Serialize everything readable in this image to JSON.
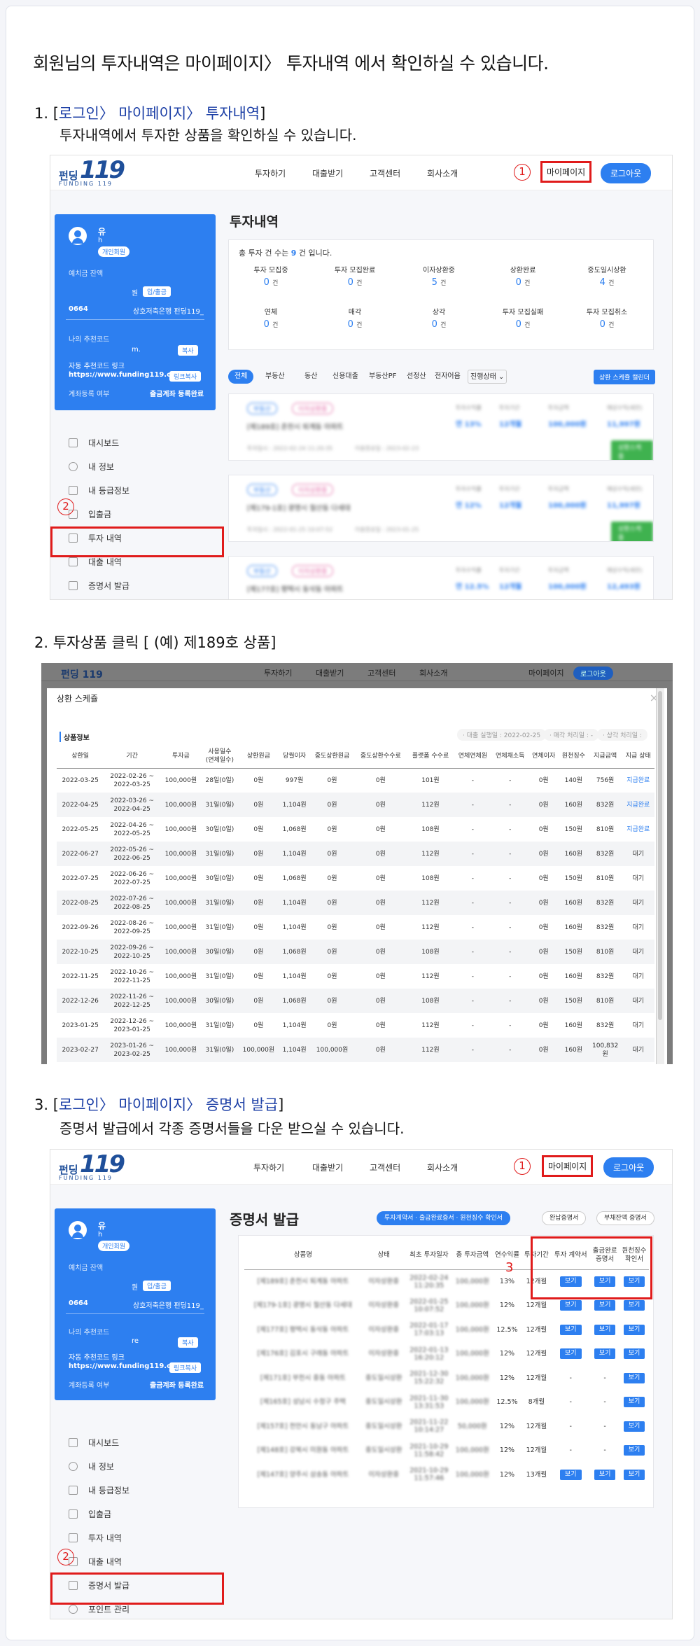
{
  "intro": "회원님의 투자내역은 마이페이지〉 투자내역 에서 확인하실 수 있습니다.",
  "sections": [
    {
      "num": "1. [",
      "path": "로그인〉 마이페이지〉 투자내역",
      "close": "]",
      "desc": "투자내역에서 투자한 상품을 확인하실 수 있습니다."
    },
    {
      "title": "2. 투자상품 클릭 [ (예) 제189호 상품]"
    },
    {
      "num": "3. [",
      "path": "로그인〉 마이페이지〉 증명서 발급",
      "close": "]",
      "desc": "증명서 발급에서 각종 증명서들을 다운 받으실 수 있습니다."
    }
  ],
  "site": {
    "logo_ko": "펀딩",
    "logo_mark": "119",
    "logo_en": "FUNDING 119",
    "nav": [
      "투자하기",
      "대출받기",
      "고객센터",
      "회사소개"
    ],
    "mypage": "마이페이지",
    "logout": "로그아웃"
  },
  "markers": {
    "one": "1",
    "two": "2",
    "three": "3"
  },
  "profile": {
    "name": "유",
    "handle": "h",
    "member_tag": "개인회원",
    "deposit_label": "예치금 잔액",
    "deposit_unit": "원",
    "deposit_btn": "입/출금",
    "account_no": "0664",
    "bank": "상호저축은행 펀딩119_",
    "ref_code_label": "나의 추천코드",
    "ref_code": "m.",
    "ref_code_3": "re",
    "copy_btn": "복사",
    "ref_link_label": "자동 추천코드 링크",
    "ref_link": "https://www.funding119.co.kr",
    "link_copy_btn": "링크복사",
    "reg_label": "계좌등록 여부",
    "reg_value": "출금계좌 등록완료"
  },
  "menu1": [
    "대시보드",
    "내 정보",
    "내 등급정보",
    "입출금",
    "투자 내역",
    "대출 내역",
    "증명서 발급"
  ],
  "menu3": [
    "대시보드",
    "내 정보",
    "내 등급정보",
    "입출금",
    "투자 내역",
    "대출 내역",
    "증명서 발급",
    "포인트 관리"
  ],
  "invest": {
    "title": "투자내역",
    "total_pre": "총 투자 건 수는",
    "total_count": "9",
    "total_post": "건 입니다.",
    "cells": [
      {
        "label": "투자 모집중",
        "value": "0",
        "unit": "건"
      },
      {
        "label": "투자 모집완료",
        "value": "0",
        "unit": "건"
      },
      {
        "label": "이자상환중",
        "value": "5",
        "unit": "건"
      },
      {
        "label": "상환완료",
        "value": "0",
        "unit": "건"
      },
      {
        "label": "중도일시상환",
        "value": "4",
        "unit": "건"
      },
      {
        "label": "연체",
        "value": "0",
        "unit": "건"
      },
      {
        "label": "매각",
        "value": "0",
        "unit": "건"
      },
      {
        "label": "상각",
        "value": "0",
        "unit": "건"
      },
      {
        "label": "투자 모집실패",
        "value": "0",
        "unit": "건"
      },
      {
        "label": "투자 모집취소",
        "value": "0",
        "unit": "건"
      }
    ],
    "filters": [
      "전체",
      "부동산",
      "동산",
      "신용대출",
      "부동산PF",
      "선정산",
      "전자어음",
      "진행상태 ⌄"
    ],
    "calendar_btn": "상환 스케쥴 캘린더",
    "cards": [
      {
        "badge1": "부동산",
        "badge2": "이자상환중",
        "name": "[제189호] 춘천시 퇴계동 아파트",
        "rate": "연 13%",
        "period": "12개월",
        "amount": "100,000원",
        "interest": "11,997원",
        "date": "투자일시 : 2022-02-24 11:20:35",
        "date2": "이용종료일 : 2023-02-23",
        "btn": "상환스케줄",
        "h1": "투자수익률",
        "h2": "투자기간",
        "h3": "투자금액",
        "h4": "예상수익(세전)"
      },
      {
        "badge1": "부동산",
        "badge2": "이자상환중",
        "name": "[제179-1호] 광명시 철산동 다세대",
        "rate": "연 12%",
        "period": "12개월",
        "amount": "100,000원",
        "interest": "11,997원",
        "date": "투자일시 : 2022-01-25 10:07:52",
        "date2": "이용종료일 : 2023-01-25",
        "btn": "상환스케줄",
        "h1": "투자수익률",
        "h2": "투자기간",
        "h3": "투자금액",
        "h4": "예상수익(세전)"
      },
      {
        "badge1": "부동산",
        "badge2": "이자상환중",
        "name": "[제177호] 평택시 동삭동 아파트",
        "rate": "연 12.5%",
        "period": "12개월",
        "amount": "100,000원",
        "interest": "12,493원",
        "h1": "투자수익률",
        "h2": "투자기간",
        "h3": "투자금액",
        "h4": "예상수익(세전)"
      }
    ]
  },
  "schedule": {
    "title": "상환 스케쥴",
    "close": "×",
    "section": "상품정보",
    "info1": "· 대출 실행일 : 2022-02-25",
    "info2": "· 매각 처리일 : -",
    "info3": "· 상각 처리일 :",
    "headers": [
      "상환일",
      "기간",
      "투자금",
      "사용일수\n(연체일수)",
      "상환원금",
      "당월이자",
      "중도상환원금",
      "중도상환수수료",
      "플랫폼 수수료",
      "연체연체원",
      "연체채소득",
      "연체이자",
      "원천징수",
      "지급금액",
      "지급 상태"
    ],
    "rows": [
      [
        "2022-03-25",
        "2022-02-26 ~\n2022-03-25",
        "100,000원",
        "28일(0일)",
        "0원",
        "997원",
        "0원",
        "0원",
        "101원",
        "-",
        "-",
        "0원",
        "140원",
        "756원",
        "지급완료"
      ],
      [
        "2022-04-25",
        "2022-03-26 ~\n2022-04-25",
        "100,000원",
        "31일(0일)",
        "0원",
        "1,104원",
        "0원",
        "0원",
        "112원",
        "-",
        "-",
        "0원",
        "160원",
        "832원",
        "지급완료"
      ],
      [
        "2022-05-25",
        "2022-04-26 ~\n2022-05-25",
        "100,000원",
        "30일(0일)",
        "0원",
        "1,068원",
        "0원",
        "0원",
        "108원",
        "-",
        "-",
        "0원",
        "150원",
        "810원",
        "지급완료"
      ],
      [
        "2022-06-27",
        "2022-05-26 ~\n2022-06-25",
        "100,000원",
        "31일(0일)",
        "0원",
        "1,104원",
        "0원",
        "0원",
        "112원",
        "-",
        "-",
        "0원",
        "160원",
        "832원",
        "대기"
      ],
      [
        "2022-07-25",
        "2022-06-26 ~\n2022-07-25",
        "100,000원",
        "30일(0일)",
        "0원",
        "1,068원",
        "0원",
        "0원",
        "108원",
        "-",
        "-",
        "0원",
        "150원",
        "810원",
        "대기"
      ],
      [
        "2022-08-25",
        "2022-07-26 ~\n2022-08-25",
        "100,000원",
        "31일(0일)",
        "0원",
        "1,104원",
        "0원",
        "0원",
        "112원",
        "-",
        "-",
        "0원",
        "160원",
        "832원",
        "대기"
      ],
      [
        "2022-09-26",
        "2022-08-26 ~\n2022-09-25",
        "100,000원",
        "31일(0일)",
        "0원",
        "1,104원",
        "0원",
        "0원",
        "112원",
        "-",
        "-",
        "0원",
        "160원",
        "832원",
        "대기"
      ],
      [
        "2022-10-25",
        "2022-09-26 ~\n2022-10-25",
        "100,000원",
        "30일(0일)",
        "0원",
        "1,068원",
        "0원",
        "0원",
        "108원",
        "-",
        "-",
        "0원",
        "150원",
        "810원",
        "대기"
      ],
      [
        "2022-11-25",
        "2022-10-26 ~\n2022-11-25",
        "100,000원",
        "31일(0일)",
        "0원",
        "1,104원",
        "0원",
        "0원",
        "112원",
        "-",
        "-",
        "0원",
        "160원",
        "832원",
        "대기"
      ],
      [
        "2022-12-26",
        "2022-11-26 ~\n2022-12-25",
        "100,000원",
        "30일(0일)",
        "0원",
        "1,068원",
        "0원",
        "0원",
        "108원",
        "-",
        "-",
        "0원",
        "150원",
        "810원",
        "대기"
      ],
      [
        "2023-01-25",
        "2022-12-26 ~\n2023-01-25",
        "100,000원",
        "31일(0일)",
        "0원",
        "1,104원",
        "0원",
        "0원",
        "112원",
        "-",
        "-",
        "0원",
        "160원",
        "832원",
        "대기"
      ],
      [
        "2023-02-27",
        "2023-01-26 ~\n2023-02-25",
        "100,000원",
        "31일(0일)",
        "100,000원",
        "1,104원",
        "100,000원",
        "0원",
        "112원",
        "-",
        "-",
        "0원",
        "160원",
        "100,832\n원",
        "대기"
      ]
    ]
  },
  "cert": {
    "title": "증명서 발급",
    "tabs": [
      "투자계약서 · 출금완료증서 · 원천징수 확인서",
      "완납증명서",
      "부채잔액 증명서"
    ],
    "headers": [
      "상품명",
      "상태",
      "최초 투자일자",
      "총 투자금액",
      "연수익률",
      "투자기간",
      "투자 계약서",
      "출금완료\n증명서",
      "원천징수\n확인서"
    ],
    "view": "보기",
    "rows": [
      [
        "[제189호] 춘천시 퇴계동 아파트",
        "이자상환중",
        "2022-02-24\n11:20:35",
        "100,000원",
        "13%",
        "12개월",
        "보기",
        "보기",
        "보기"
      ],
      [
        "[제179-1호] 광명시 철산동 다세대",
        "이자상환중",
        "2022-01-25\n10:07:52",
        "100,000원",
        "12%",
        "12개월",
        "보기",
        "보기",
        "보기"
      ],
      [
        "[제177호] 평택시 동삭동 아파트",
        "이자상환중",
        "2022-01-17\n17:03:13",
        "100,000원",
        "12.5%",
        "12개월",
        "보기",
        "보기",
        "보기"
      ],
      [
        "[제176호] 김포시 구래동 아파트",
        "이자상환중",
        "2022-01-13\n16:20:12",
        "100,000원",
        "12%",
        "12개월",
        "보기",
        "보기",
        "보기"
      ],
      [
        "[제171호] 부천시 중동 아파트",
        "중도일시상환",
        "2021-12-30\n15:22:32",
        "100,000원",
        "12%",
        "12개월",
        "-",
        "-",
        "보기"
      ],
      [
        "[제165호] 성남시 수정구 주택",
        "중도일시상환",
        "2021-11-30\n13:31:53",
        "100,000원",
        "12.5%",
        "8개월",
        "-",
        "-",
        "보기"
      ],
      [
        "[제157호] 천안시 동남구 아파트",
        "중도일시상환",
        "2021-11-22\n10:14:27",
        "50,000원",
        "12%",
        "12개월",
        "-",
        "-",
        "보기"
      ],
      [
        "[제148호] 강북시 미원동 아파트",
        "중도일시상환",
        "2021-10-29\n11:58:42",
        "100,000원",
        "12%",
        "12개월",
        "-",
        "-",
        "보기"
      ],
      [
        "[제147호] 양주시 삼송동 아파트",
        "이자상환중",
        "2021-10-29\n11:57:46",
        "100,000원",
        "12%",
        "13개월",
        "보기",
        "보기",
        "보기"
      ]
    ]
  }
}
